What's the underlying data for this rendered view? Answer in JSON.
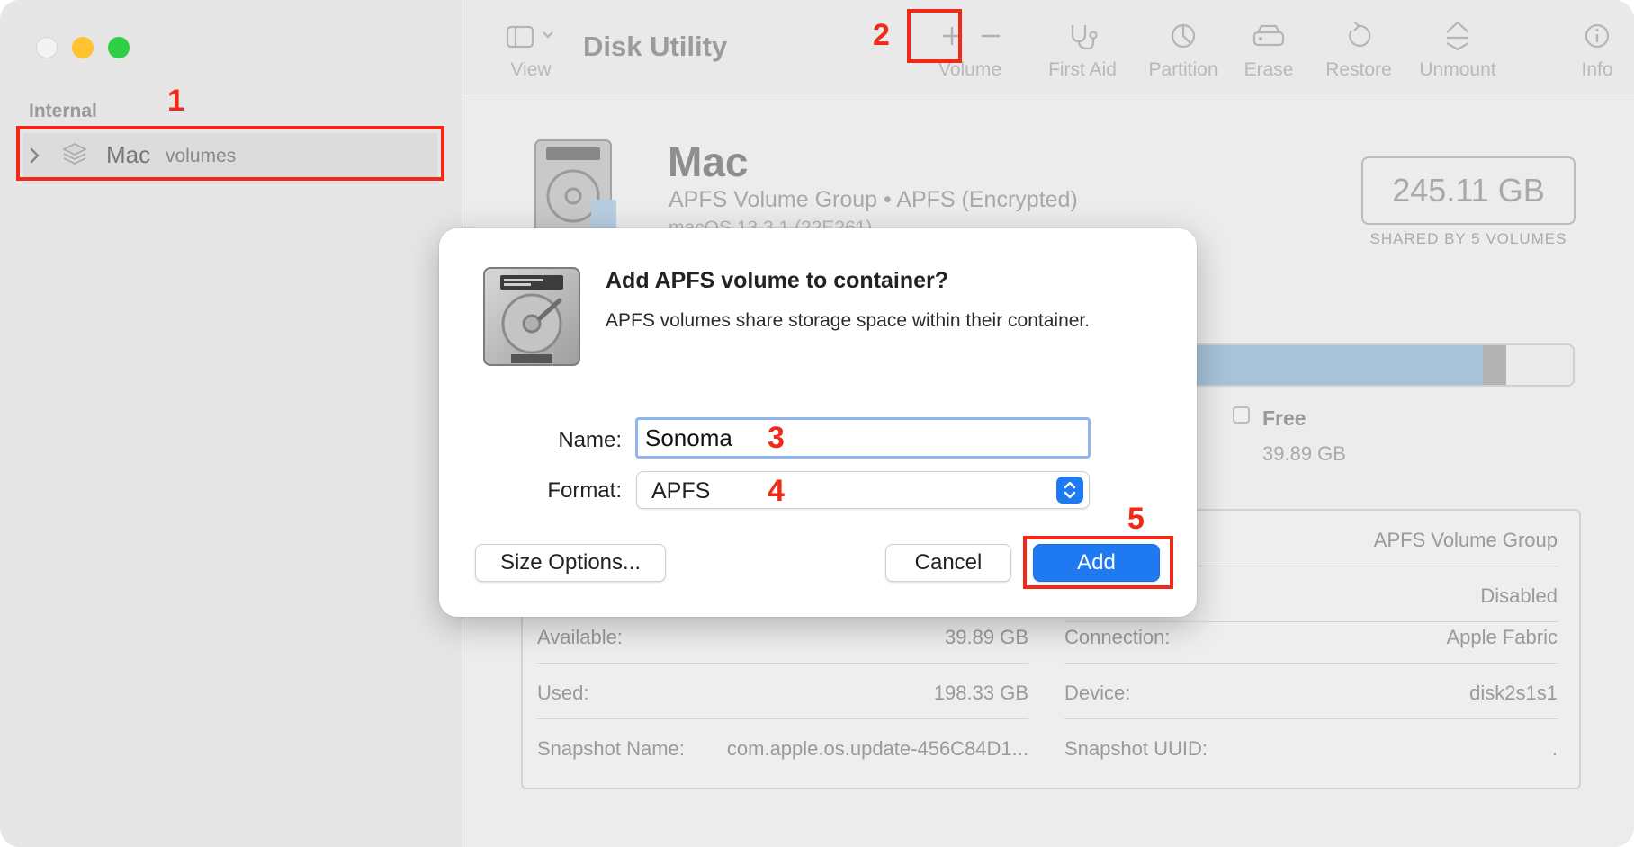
{
  "app": {
    "title": "Disk Utility"
  },
  "sidebar": {
    "section": "Internal",
    "item": {
      "name": "Mac",
      "sub": "volumes"
    }
  },
  "toolbar": {
    "view": "View",
    "volume": "Volume",
    "first_aid": "First Aid",
    "partition": "Partition",
    "erase": "Erase",
    "restore": "Restore",
    "unmount": "Unmount",
    "info": "Info"
  },
  "disk": {
    "name": "Mac",
    "type": "APFS Volume Group • APFS (Encrypted)",
    "os": "macOS 13.3.1 (22E261)",
    "capacity": "245.11 GB",
    "capacity_sub": "SHARED BY 5 VOLUMES",
    "usage": {
      "used_fraction": 0.81,
      "other_fraction": 0.05
    },
    "free_label": "Free",
    "free_value": "39.89 GB"
  },
  "info": {
    "left": [
      {
        "key": "",
        "value": ""
      },
      {
        "key": "",
        "value": ""
      },
      {
        "key": "Available:",
        "value": "39.89 GB"
      },
      {
        "key": "Used:",
        "value": "198.33 GB"
      },
      {
        "key": "Snapshot Name:",
        "value": "com.apple.os.update-456C84D1..."
      }
    ],
    "right": [
      {
        "key": "",
        "value": "APFS Volume Group"
      },
      {
        "key": "",
        "value": "Disabled"
      },
      {
        "key": "Connection:",
        "value": "Apple Fabric"
      },
      {
        "key": "Device:",
        "value": "disk2s1s1"
      },
      {
        "key": "Snapshot UUID:",
        "value": "."
      }
    ]
  },
  "dialog": {
    "title": "Add APFS volume to container?",
    "description": "APFS volumes share storage space within their container.",
    "name_label": "Name:",
    "name_value": "Sonoma",
    "format_label": "Format:",
    "format_value": "APFS",
    "size_options": "Size Options...",
    "cancel": "Cancel",
    "add": "Add"
  },
  "annotations": [
    "1",
    "2",
    "3",
    "4",
    "5"
  ],
  "colors": {
    "accent": "#1f7af2",
    "annotation": "#ef2a16"
  }
}
